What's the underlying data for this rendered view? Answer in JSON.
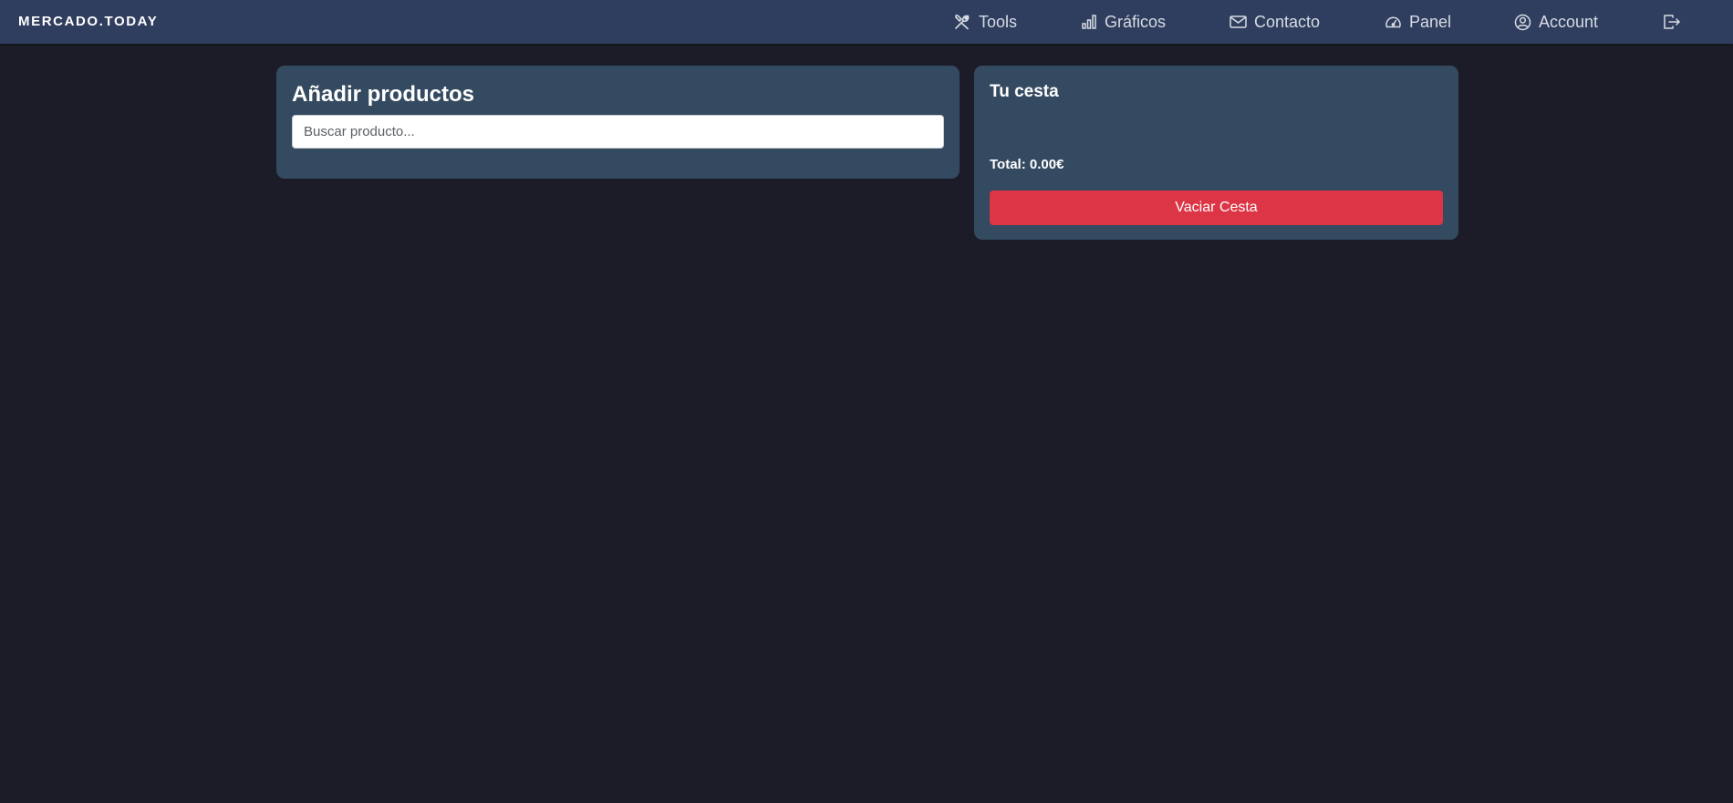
{
  "brand": "MERCADO.TODAY",
  "nav": {
    "items": [
      {
        "label": "Tools",
        "icon": "tools-icon"
      },
      {
        "label": "Gráficos",
        "icon": "bar-chart-icon"
      },
      {
        "label": "Contacto",
        "icon": "envelope-icon"
      },
      {
        "label": "Panel",
        "icon": "speedometer-icon"
      },
      {
        "label": "Account",
        "icon": "user-circle-icon"
      }
    ],
    "logout_icon": "logout-icon"
  },
  "add_products": {
    "title": "Añadir productos",
    "search_placeholder": "Buscar producto...",
    "search_value": ""
  },
  "basket": {
    "title": "Tu cesta",
    "total": "Total: 0.00€",
    "empty_button": "Vaciar Cesta"
  },
  "colors": {
    "page_bg": "#1b1c27",
    "navbar_bg": "#2f3e5e",
    "card_bg": "#344a60",
    "danger": "#dc3545"
  }
}
